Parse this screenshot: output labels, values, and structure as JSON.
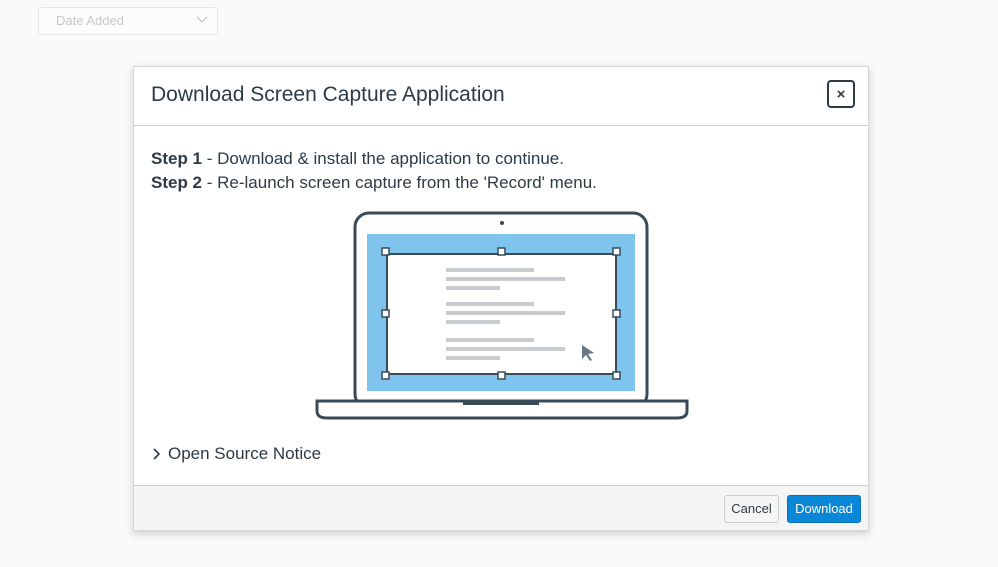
{
  "background": {
    "sort_select": {
      "value": "Date Added",
      "icon": "chevron-down-icon"
    }
  },
  "dialog": {
    "title": "Download Screen Capture Application",
    "close_label": "×",
    "steps": [
      {
        "label": "Step 1",
        "text": " - Download & install the application to continue."
      },
      {
        "label": "Step 2",
        "text": " - Re-launch screen capture from the 'Record' menu."
      }
    ],
    "open_source_notice": "Open Source Notice",
    "buttons": {
      "cancel": "Cancel",
      "download": "Download"
    }
  },
  "colors": {
    "primary": "#0b87d8",
    "text": "#2d3b45",
    "illustration_screen": "#7fc4ec",
    "illustration_outline": "#394b58"
  }
}
